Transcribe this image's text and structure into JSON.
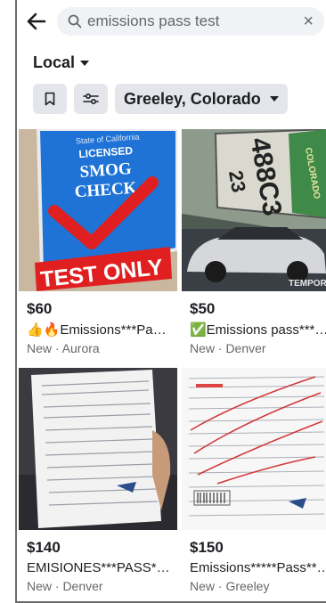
{
  "search": {
    "value": "emissions pass test",
    "clear_label": "×"
  },
  "filters": {
    "scope_label": "Local",
    "location_label": "Greeley, Colorado"
  },
  "listings": [
    {
      "price": "$60",
      "title": "👍🔥Emissions***Pa…",
      "condition": "New",
      "city": "Aurora",
      "meta": "New · Aurora",
      "image_text": {
        "line1": "State of California",
        "line2": "LICENSED",
        "line3": "SMOG",
        "line4": "CHECK",
        "banner": "TEST ONLY"
      }
    },
    {
      "price": "$50",
      "title": "✅Emissions pass***…",
      "condition": "New",
      "city": "Denver",
      "meta": "New · Denver",
      "image_text": {
        "plate": "488C3",
        "num": "23",
        "state": "COLORADO",
        "watermark": "TEMPORAL"
      }
    },
    {
      "price": "$140",
      "title": "EMISIONES***PASS*…",
      "condition": "New",
      "city": "Denver",
      "meta": "New · Denver"
    },
    {
      "price": "$150",
      "title": "Emissions*****Pass**…",
      "condition": "New",
      "city": "Greeley",
      "meta": "New · Greeley"
    }
  ],
  "icons": [
    "back-arrow-icon",
    "search-icon",
    "bookmark-icon",
    "sliders-icon",
    "caret-down-icon"
  ],
  "colors": {
    "accent_red": "#e02020",
    "smog_blue": "#1f73d6",
    "chip_bg": "#e4e6eb",
    "search_bg": "#f0f2f5",
    "muted": "#65676b"
  }
}
